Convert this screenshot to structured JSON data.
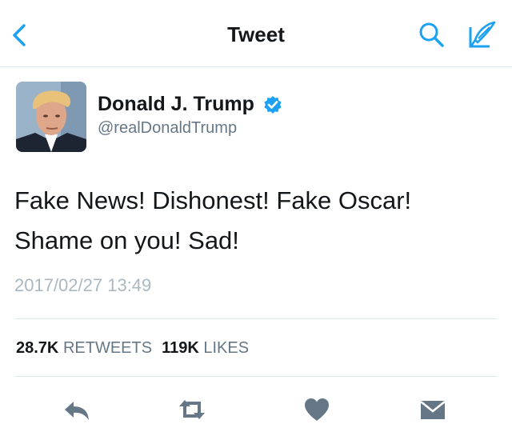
{
  "nav": {
    "title": "Tweet"
  },
  "tweet": {
    "author_name": "Donald J. Trump",
    "author_handle": "@realDonaldTrump",
    "text_line1": "Fake News! Dishonest! Fake Oscar!",
    "text_line2": "Shame on you! Sad!",
    "timestamp": "2017/02/27 13:49",
    "retweets_count": "28.7K",
    "retweets_label": "RETWEETS",
    "likes_count": "119K",
    "likes_label": "LIKES"
  },
  "icons": {
    "back": "chevron-left-icon",
    "search": "search-icon",
    "compose": "compose-icon",
    "verified": "verified-badge-icon",
    "reply": "reply-icon",
    "retweet": "retweet-icon",
    "like": "heart-icon",
    "dm": "envelope-icon"
  },
  "colors": {
    "accent": "#1da1f2",
    "action_icon": "#657786",
    "secondary_text": "#657786",
    "timestamp_text": "#aab8c2"
  }
}
